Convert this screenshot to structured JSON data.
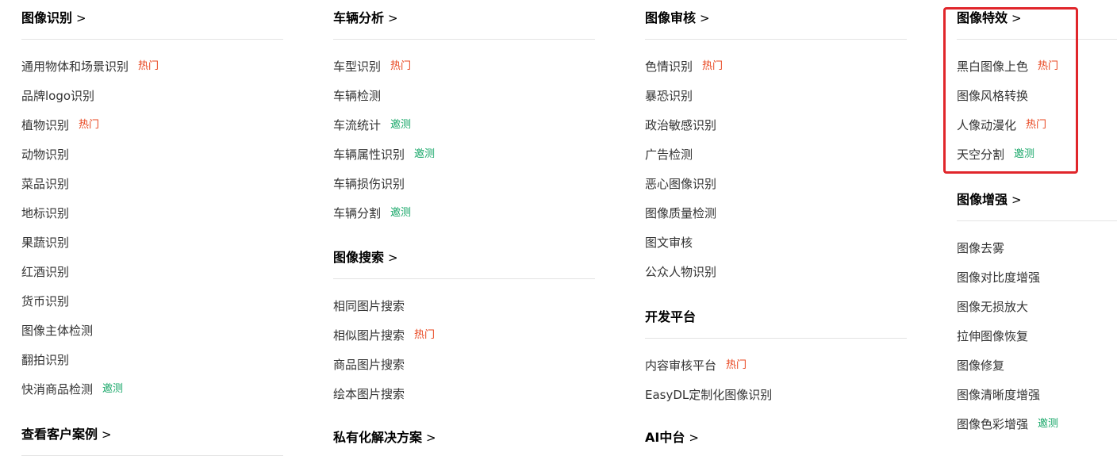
{
  "columns": [
    {
      "sections": [
        {
          "title": "图像识别",
          "arrow": ">",
          "items": [
            {
              "label": "通用物体和场景识别",
              "badge": "热门",
              "badge_type": "hot"
            },
            {
              "label": "品牌logo识别",
              "badge": "",
              "badge_type": ""
            },
            {
              "label": "植物识别",
              "badge": "热门",
              "badge_type": "hot"
            },
            {
              "label": "动物识别",
              "badge": "",
              "badge_type": ""
            },
            {
              "label": "菜品识别",
              "badge": "",
              "badge_type": ""
            },
            {
              "label": "地标识别",
              "badge": "",
              "badge_type": ""
            },
            {
              "label": "果蔬识别",
              "badge": "",
              "badge_type": ""
            },
            {
              "label": "红酒识别",
              "badge": "",
              "badge_type": ""
            },
            {
              "label": "货币识别",
              "badge": "",
              "badge_type": ""
            },
            {
              "label": "图像主体检测",
              "badge": "",
              "badge_type": ""
            },
            {
              "label": "翻拍识别",
              "badge": "",
              "badge_type": ""
            },
            {
              "label": "快消商品检测",
              "badge": "邀测",
              "badge_type": "beta"
            }
          ]
        },
        {
          "title": "查看客户案例",
          "arrow": ">",
          "items": []
        }
      ]
    },
    {
      "sections": [
        {
          "title": "车辆分析",
          "arrow": ">",
          "items": [
            {
              "label": "车型识别",
              "badge": "热门",
              "badge_type": "hot"
            },
            {
              "label": "车辆检测",
              "badge": "",
              "badge_type": ""
            },
            {
              "label": "车流统计",
              "badge": "邀测",
              "badge_type": "beta"
            },
            {
              "label": "车辆属性识别",
              "badge": "邀测",
              "badge_type": "beta"
            },
            {
              "label": "车辆损伤识别",
              "badge": "",
              "badge_type": ""
            },
            {
              "label": "车辆分割",
              "badge": "邀测",
              "badge_type": "beta"
            }
          ]
        },
        {
          "title": "图像搜索",
          "arrow": ">",
          "items": [
            {
              "label": "相同图片搜索",
              "badge": "",
              "badge_type": ""
            },
            {
              "label": "相似图片搜索",
              "badge": "热门",
              "badge_type": "hot"
            },
            {
              "label": "商品图片搜索",
              "badge": "",
              "badge_type": ""
            },
            {
              "label": "绘本图片搜索",
              "badge": "",
              "badge_type": ""
            }
          ]
        },
        {
          "title": "私有化解决方案",
          "arrow": ">",
          "items": []
        }
      ]
    },
    {
      "sections": [
        {
          "title": "图像审核",
          "arrow": ">",
          "items": [
            {
              "label": "色情识别",
              "badge": "热门",
              "badge_type": "hot"
            },
            {
              "label": "暴恐识别",
              "badge": "",
              "badge_type": ""
            },
            {
              "label": "政治敏感识别",
              "badge": "",
              "badge_type": ""
            },
            {
              "label": "广告检测",
              "badge": "",
              "badge_type": ""
            },
            {
              "label": "恶心图像识别",
              "badge": "",
              "badge_type": ""
            },
            {
              "label": "图像质量检测",
              "badge": "",
              "badge_type": ""
            },
            {
              "label": "图文审核",
              "badge": "",
              "badge_type": ""
            },
            {
              "label": "公众人物识别",
              "badge": "",
              "badge_type": ""
            }
          ]
        },
        {
          "title": "开发平台",
          "arrow": "",
          "items": [
            {
              "label": "内容审核平台",
              "badge": "热门",
              "badge_type": "hot"
            },
            {
              "label": "EasyDL定制化图像识别",
              "badge": "",
              "badge_type": ""
            }
          ]
        },
        {
          "title": "AI中台",
          "arrow": ">",
          "items": []
        }
      ]
    },
    {
      "sections": [
        {
          "title": "图像特效",
          "arrow": ">",
          "items": [
            {
              "label": "黑白图像上色",
              "badge": "热门",
              "badge_type": "hot"
            },
            {
              "label": "图像风格转换",
              "badge": "",
              "badge_type": ""
            },
            {
              "label": "人像动漫化",
              "badge": "热门",
              "badge_type": "hot"
            },
            {
              "label": "天空分割",
              "badge": "邀测",
              "badge_type": "beta"
            }
          ]
        },
        {
          "title": "图像增强",
          "arrow": ">",
          "items": [
            {
              "label": "图像去雾",
              "badge": "",
              "badge_type": ""
            },
            {
              "label": "图像对比度增强",
              "badge": "",
              "badge_type": ""
            },
            {
              "label": "图像无损放大",
              "badge": "",
              "badge_type": ""
            },
            {
              "label": "拉伸图像恢复",
              "badge": "",
              "badge_type": ""
            },
            {
              "label": "图像修复",
              "badge": "",
              "badge_type": ""
            },
            {
              "label": "图像清晰度增强",
              "badge": "",
              "badge_type": ""
            },
            {
              "label": "图像色彩增强",
              "badge": "邀测",
              "badge_type": "beta"
            }
          ]
        }
      ]
    }
  ],
  "colors": {
    "hot": "#e8451e",
    "beta": "#1aa86a",
    "highlight": "#e0262b"
  }
}
